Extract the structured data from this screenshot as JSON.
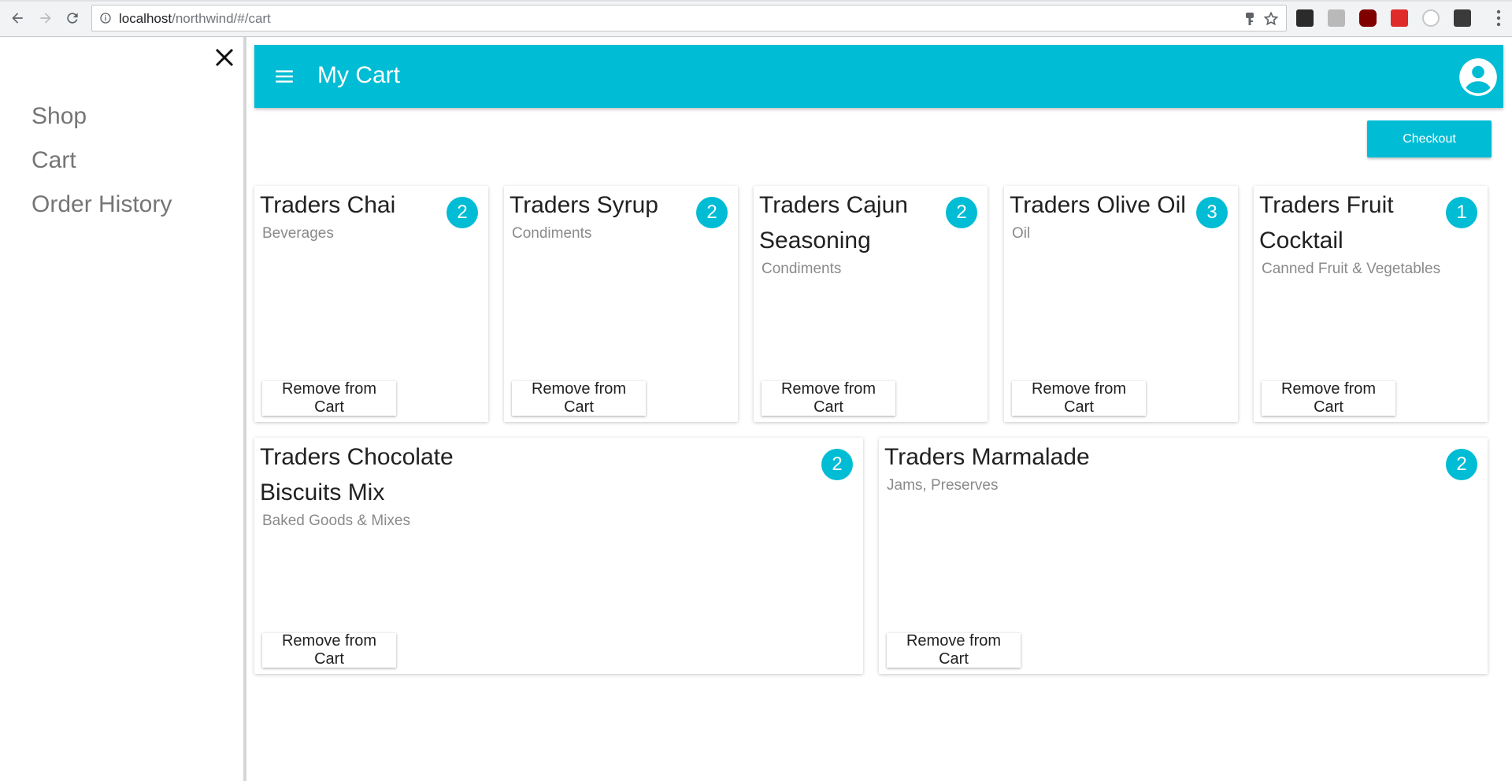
{
  "browser": {
    "url_host": "localhost",
    "url_path": "/northwind/#/cart"
  },
  "drawer": {
    "items": [
      {
        "label": "Shop"
      },
      {
        "label": "Cart"
      },
      {
        "label": "Order History"
      }
    ]
  },
  "appbar": {
    "title": "My Cart"
  },
  "checkout": {
    "label": "Checkout"
  },
  "cart": {
    "remove_label": "Remove from Cart",
    "items": [
      {
        "name": "Traders Chai",
        "category": "Beverages",
        "quantity": "2"
      },
      {
        "name": "Traders Syrup",
        "category": "Condiments",
        "quantity": "2"
      },
      {
        "name": "Traders Cajun Seasoning",
        "category": "Condiments",
        "quantity": "2"
      },
      {
        "name": "Traders Olive Oil",
        "category": "Oil",
        "quantity": "3"
      },
      {
        "name": "Traders Fruit Cocktail",
        "category": "Canned Fruit & Vegetables",
        "quantity": "1"
      },
      {
        "name": "Traders Chocolate Biscuits Mix",
        "category": "Baked Goods & Mixes",
        "quantity": "2"
      },
      {
        "name": "Traders Marmalade",
        "category": "Jams, Preserves",
        "quantity": "2"
      }
    ]
  },
  "colors": {
    "accent": "#00bcd4",
    "drawer_text": "#757575",
    "category_text": "#8a8a8a"
  },
  "icons": {
    "back": "arrow-left-icon",
    "forward": "arrow-right-icon",
    "reload": "reload-icon",
    "info": "info-icon",
    "key": "key-icon",
    "bookmark": "star-icon",
    "close": "close-icon",
    "menu": "hamburger-icon",
    "account": "account-circle-icon"
  }
}
